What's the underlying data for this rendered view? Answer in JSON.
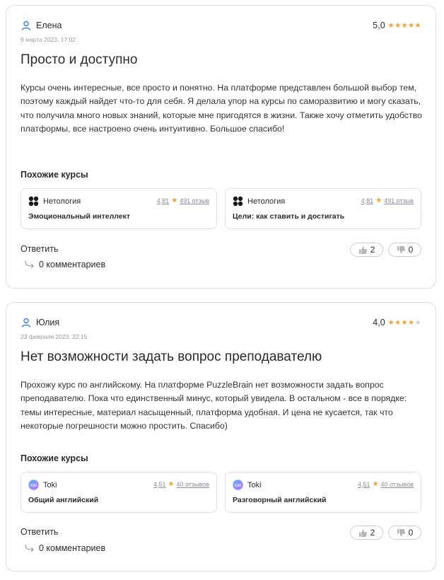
{
  "reviews": [
    {
      "author": "Елена",
      "date": "9 марта 2023, 17:02",
      "rating": "5,0",
      "stars_filled": 5,
      "title": "Просто и доступно",
      "text": "Курсы очень интересные, все просто и понятно. На платформе представлен большой выбор тем, поэтому каждый найдет что-то для себя. Я делала упор на курсы по саморазвитию и могу сказать, что получила много новых знаний, которые мне пригодятся в жизни. Также хочу отметить удобство платформы, все настроено очень интуитивно. Большое спасибо!",
      "similar_heading": "Похожие курсы",
      "courses": [
        {
          "school": "Нетология",
          "rating": "4,81",
          "reviews": "491 отзыв",
          "name": "Эмоциональный интеллект",
          "logo": "netology-logo"
        },
        {
          "school": "Нетология",
          "rating": "4,81",
          "reviews": "491 отзыв",
          "name": "Цели: как ставить и достигать",
          "logo": "netology-logo"
        }
      ],
      "reply_label": "Ответить",
      "comments_label": "0 комментариев",
      "likes": "2",
      "dislikes": "0"
    },
    {
      "author": "Юлия",
      "date": "23 февраля 2023, 22:15",
      "rating": "4,0",
      "stars_filled": 4,
      "title": "Нет возможности задать вопрос преподавателю",
      "text": "Прохожу курс по английскому. На платформе PuzzleBrain нет возможности задать вопрос преподавателю. Пока что единственный минус, который увидела. В остальном - все в порядке: темы интересные, материал насыщенный, платформа удобная. И цена не кусается, так что некоторые погрешности можно простить. Спасибо)",
      "similar_heading": "Похожие курсы",
      "courses": [
        {
          "school": "Toki",
          "rating": "4,51",
          "reviews": "40 отзывов",
          "name": "Общий английский",
          "logo": "toki-logo"
        },
        {
          "school": "Toki",
          "rating": "4,51",
          "reviews": "40 отзывов",
          "name": "Разговорный английский",
          "logo": "toki-logo"
        }
      ],
      "reply_label": "Ответить",
      "comments_label": "0 комментариев",
      "likes": "2",
      "dislikes": "0"
    }
  ],
  "colors": {
    "star": "#f2a22c",
    "star_off": "#cfcfcf",
    "muted": "#9a9a9a",
    "border": "#dcdcdc",
    "user_icon": "#3d7be0"
  },
  "icons": [
    "user-icon",
    "star-icon",
    "netology-logo",
    "toki-logo",
    "thumbs-up-icon",
    "thumbs-down-icon",
    "reply-arrow-icon"
  ]
}
